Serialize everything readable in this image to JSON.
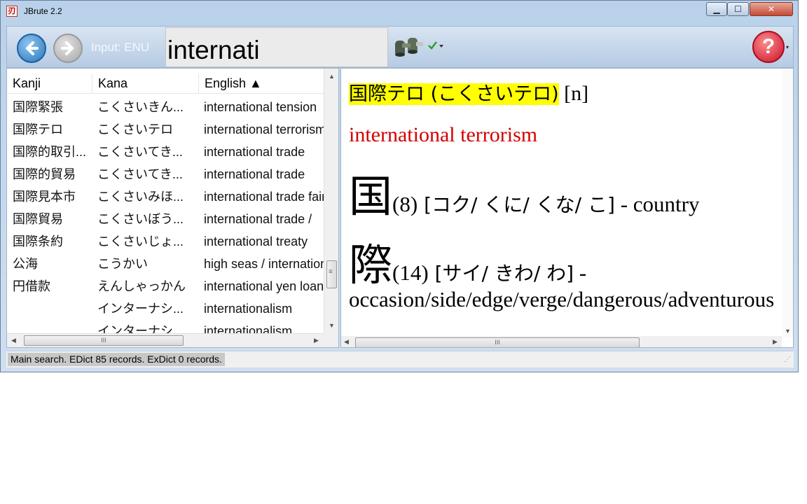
{
  "window": {
    "title": "JBrute 2.2",
    "app_icon": "jbrute-icon",
    "min": "▁",
    "max": "☐",
    "close": "✕"
  },
  "toolbar": {
    "input_label": "Input: ENU",
    "search_value": "internati",
    "help": "?",
    "help_caret": "▾"
  },
  "list": {
    "columns": {
      "kanji": "Kanji",
      "kana": "Kana",
      "english": "English ▲"
    },
    "rows": [
      {
        "kanji": "国際緊張",
        "kana": "こくさいきん...",
        "english": "international tension"
      },
      {
        "kanji": "国際テロ",
        "kana": "こくさいテロ",
        "english": "international terrorism"
      },
      {
        "kanji": "国際的取引...",
        "kana": "こくさいてき...",
        "english": "international trade"
      },
      {
        "kanji": "国際的貿易",
        "kana": "こくさいてき...",
        "english": "international trade"
      },
      {
        "kanji": "国際見本市",
        "kana": "こくさいみほ...",
        "english": "international trade fair"
      },
      {
        "kanji": "国際貿易",
        "kana": "こくさいぼう...",
        "english": "international trade / "
      },
      {
        "kanji": "国際条約",
        "kana": "こくさいじょ...",
        "english": "international treaty"
      },
      {
        "kanji": "公海",
        "kana": "こうかい",
        "english": "high seas / international"
      },
      {
        "kanji": "円借款",
        "kana": "えんしゃっかん",
        "english": "international yen loan"
      },
      {
        "kanji": "",
        "kana": "インターナシ...",
        "english": "internationalism"
      },
      {
        "kanji": "",
        "kana": "インターナシ...",
        "english": "internationalism"
      }
    ],
    "scroll_grip": "≡",
    "hscroll_grip": "III"
  },
  "detail": {
    "head_kanji": "国際",
    "head_rest": "テロ (こくさいテロ)",
    "pos": " [n]",
    "meaning": "international terrorism",
    "kanji": [
      {
        "char": "国",
        "strokes": "(8)",
        "readings": " [コク/ くに/ くな/ こ]",
        "meaning": " - country"
      },
      {
        "char": "際",
        "strokes": "(14)",
        "readings": " [サイ/ きわ/ わ]",
        "meaning": " -"
      }
    ],
    "meaning2": "occasion/side/edge/verge/dangerous/adventurous"
  },
  "status": {
    "text": "Main search.  EDict 85 records. ExDict 0 records.",
    "grip": "⋰"
  }
}
